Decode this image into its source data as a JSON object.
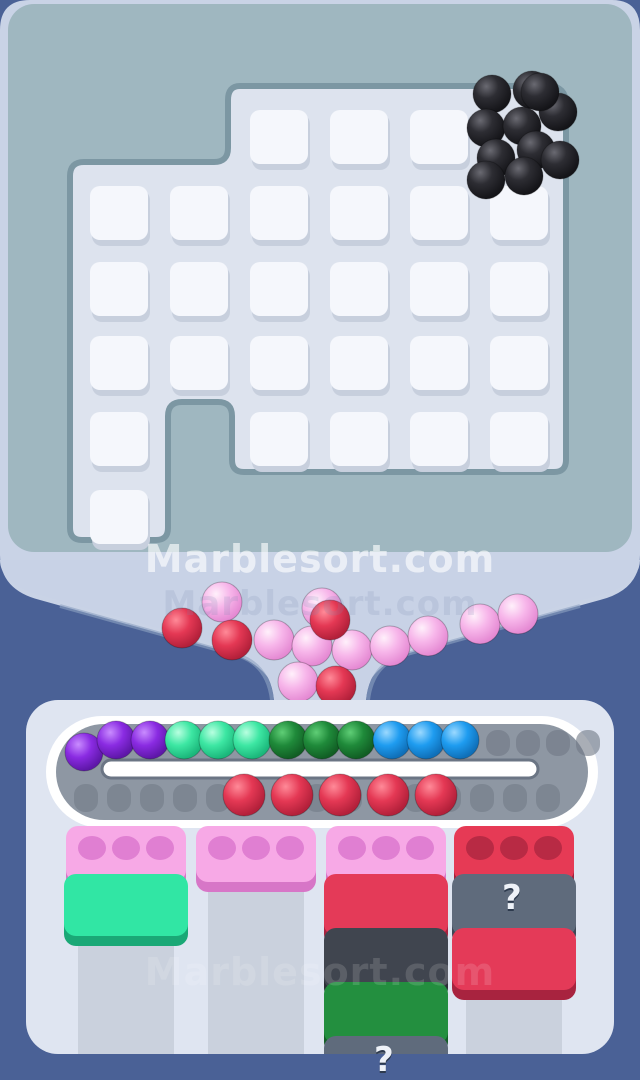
{
  "watermark": {
    "main": "Marblesort.com",
    "ghost": "Marblesort.com",
    "low": "Marblesort.com"
  },
  "colors": {
    "frame": "#4a6196",
    "board": "#9fb7c0",
    "board_floor": "#dde3ee",
    "tile": "#f5f7fc",
    "funnel": "#c9d3e6",
    "black_marble": "#2b2b30",
    "pink_marble": "#f5b2e8",
    "red_marble": "#e63a55",
    "purple_marble": "#8a2be2",
    "mint_marble": "#3ee8a4",
    "green_marble": "#1f8a3a",
    "blue_marble": "#1e9cf0",
    "pink_cup": "#f39be0",
    "red_cup": "#e23550",
    "mint_block": "#2ee5a3",
    "gray_block": "#5c6878",
    "dark_block": "#3b3f47"
  },
  "board": {
    "black_cluster_count": 11
  },
  "funnel": {
    "marbles": [
      "pink",
      "pink",
      "red",
      "red",
      "pink",
      "pink",
      "pink",
      "pink",
      "pink",
      "pink",
      "pink",
      "pink",
      "red",
      "red"
    ]
  },
  "conveyor": {
    "top_row": [
      "purple",
      "purple",
      "purple",
      "mint",
      "mint",
      "mint",
      "green",
      "green",
      "green",
      "blue",
      "blue",
      "blue"
    ],
    "bottom_row": [
      "red",
      "red",
      "red",
      "red",
      "red"
    ]
  },
  "columns": [
    {
      "cup": "pink",
      "cup_slots": 3,
      "stack": [
        "mint"
      ]
    },
    {
      "cup": "pink",
      "cup_slots": 3,
      "stack": []
    },
    {
      "cup": "pink",
      "cup_slots": 3,
      "stack": [
        "red",
        "dark",
        "green",
        "hidden"
      ]
    },
    {
      "cup": "red",
      "cup_slots": 3,
      "stack": [
        "hidden",
        "red"
      ]
    }
  ],
  "hidden_block_label": "?"
}
